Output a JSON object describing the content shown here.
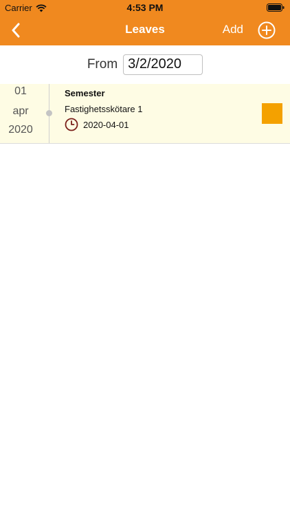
{
  "status_bar": {
    "carrier": "Carrier",
    "time": "4:53 PM",
    "icons": [
      "wifi-icon",
      "battery-icon"
    ]
  },
  "nav": {
    "title": "Leaves",
    "add_label": "Add",
    "back_icon": "chevron-left-icon",
    "add_icon": "plus-circle-icon",
    "background_color": "#F0891F"
  },
  "filter": {
    "from_label": "From",
    "from_value": "3/2/2020"
  },
  "leaves": [
    {
      "day": "01",
      "month": "apr",
      "year": "2020",
      "title": "Semester",
      "subtitle": "Fastighetsskötare 1",
      "date": "2020-04-01",
      "icon": "clock-icon",
      "color": "#F4A100"
    }
  ]
}
